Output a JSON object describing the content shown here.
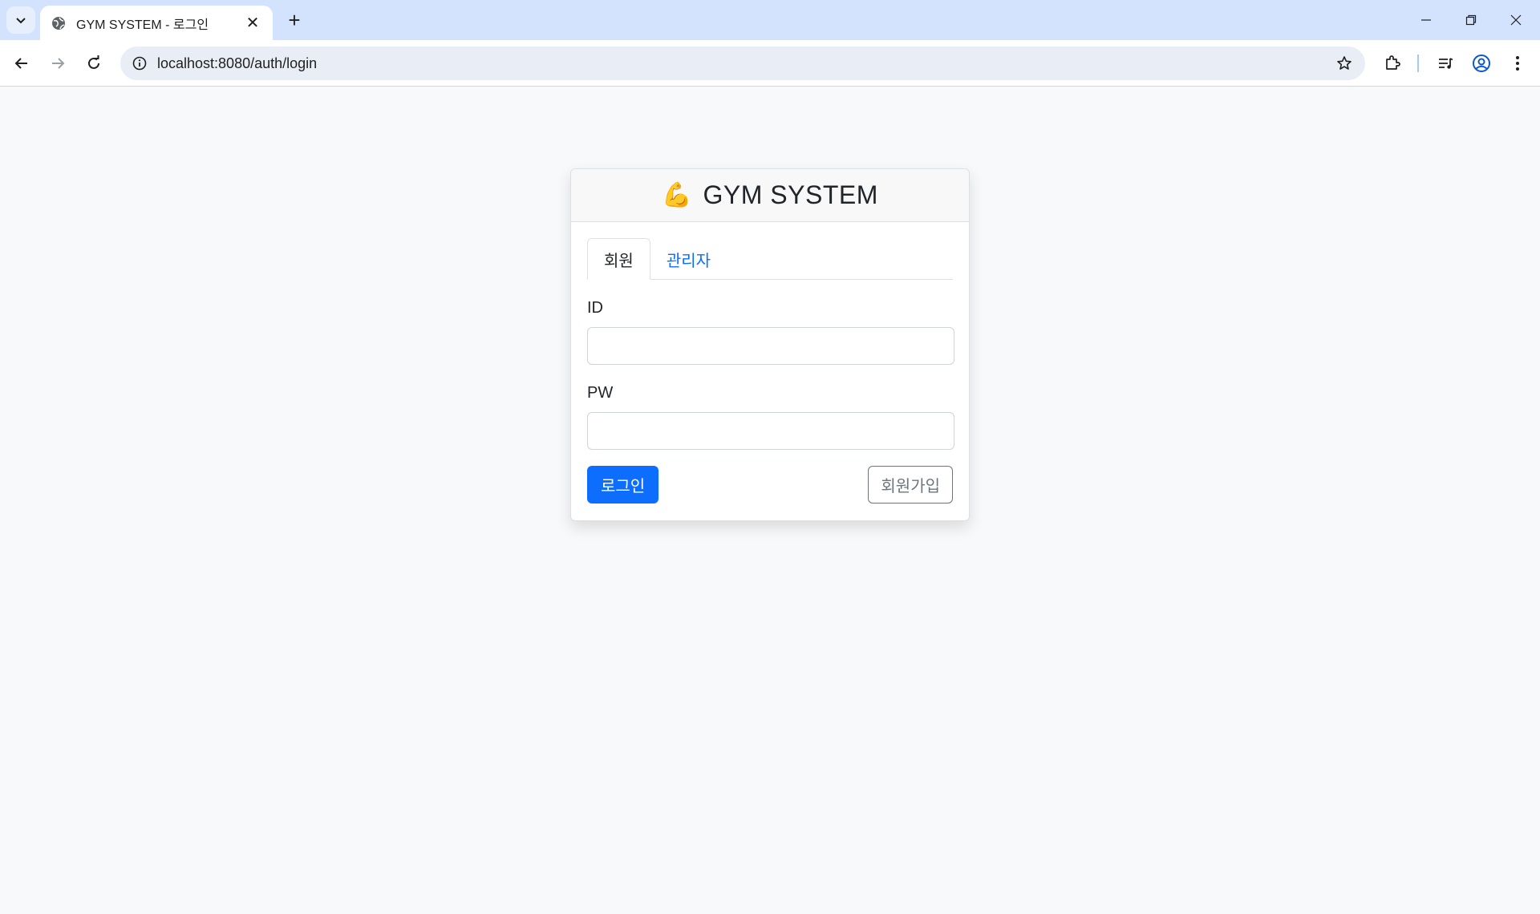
{
  "browser": {
    "tab_title": "GYM SYSTEM - 로그인",
    "tab_close": "✕",
    "new_tab": "+",
    "url": "localhost:8080/auth/login",
    "icons": {
      "tab_search": "chevron-down-icon",
      "favicon": "globe-icon",
      "back": "back-arrow-icon",
      "forward": "forward-arrow-icon",
      "reload": "reload-icon",
      "site_info": "info-icon",
      "bookmark": "star-icon",
      "extensions": "puzzle-icon",
      "media": "media-queue-icon",
      "profile": "profile-icon",
      "menu": "more-vert-icon"
    },
    "window_controls": [
      "minimize",
      "restore",
      "close"
    ]
  },
  "login_card": {
    "brand_emoji": "💪",
    "title": "GYM SYSTEM",
    "tabs": [
      {
        "label": "회원",
        "active": true
      },
      {
        "label": "관리자",
        "active": false
      }
    ],
    "id_label": "ID",
    "id_value": "",
    "pw_label": "PW",
    "pw_value": "",
    "login_button": "로그인",
    "signup_button": "회원가입"
  },
  "colors": {
    "page_bg": "#f8f9fa",
    "primary": "#0d6efd",
    "secondary": "#6c757d",
    "tabstrip_bg": "#d3e3fd"
  }
}
